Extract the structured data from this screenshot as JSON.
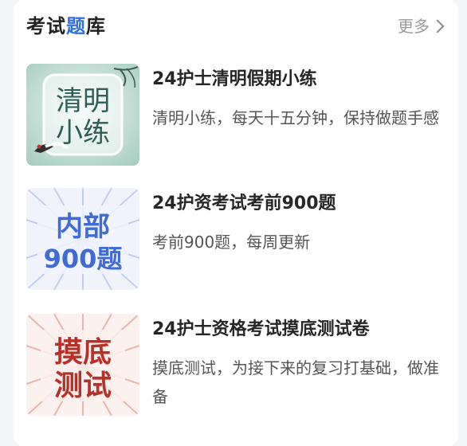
{
  "header": {
    "title_part1": "考试",
    "title_highlight": "题",
    "title_part2": "库",
    "more_label": "更多"
  },
  "items": [
    {
      "thumb_line1": "清明",
      "thumb_line2": "小练",
      "title": "24护士清明假期小练",
      "desc": "清明小练，每天十五分钟，保持做题手感"
    },
    {
      "thumb_line1": "内部",
      "thumb_line2": "900题",
      "title": "24护资考试考前900题",
      "desc": "考前900题，每周更新"
    },
    {
      "thumb_line1": "摸底",
      "thumb_line2": "测试",
      "title": "24护士资格考试摸底测试卷",
      "desc": "摸底测试，为接下来的复习打基础，做准备"
    }
  ],
  "colors": {
    "accent": "#2f6fe6",
    "thumb1_bg": "#cfe6df",
    "thumb2_text": "#3f6bd9",
    "thumb3_text": "#b5312a"
  }
}
